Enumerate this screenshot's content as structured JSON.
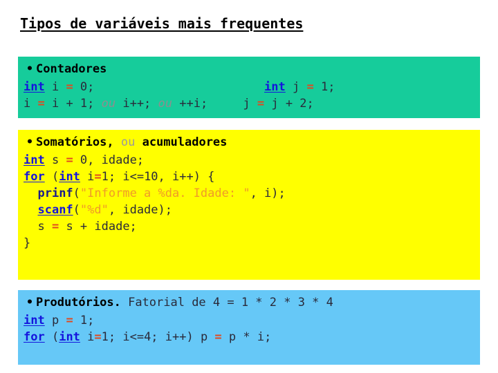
{
  "slide": {
    "title": "Tipos de variáveis mais frequentes",
    "background_color": "#ffffff"
  },
  "colors": {
    "green_block": "#16cc9b",
    "yellow_block": "#ffff00",
    "blue_block": "#66c8f7",
    "keyword": "#1414dd",
    "operator": "#e0491f",
    "string": "#f09a28",
    "comment_ou": "#8e8e8e",
    "code_text": "#2a2a3a",
    "title_text": "#000000"
  },
  "blocks": [
    {
      "id": "counters",
      "heading": {
        "bullet": "•",
        "text": "Contadores"
      },
      "lines": [
        {
          "left_tokens": [
            {
              "text": "int",
              "style": "keyword"
            },
            {
              "text": " i ",
              "style": "code"
            },
            {
              "text": "=",
              "style": "operator"
            },
            {
              "text": " 0;",
              "style": "code"
            }
          ],
          "right_tokens": [
            {
              "text": "int",
              "style": "keyword"
            },
            {
              "text": " j ",
              "style": "code"
            },
            {
              "text": "=",
              "style": "operator"
            },
            {
              "text": " 1;",
              "style": "code"
            }
          ]
        },
        {
          "left_tokens": [
            {
              "text": "i ",
              "style": "code"
            },
            {
              "text": "=",
              "style": "operator"
            },
            {
              "text": " i + 1; ",
              "style": "code"
            },
            {
              "text": "ou",
              "style": "comment"
            },
            {
              "text": " i++; ",
              "style": "code"
            },
            {
              "text": "ou",
              "style": "comment"
            },
            {
              "text": " ++i;",
              "style": "code"
            }
          ],
          "right_tokens": [
            {
              "text": "j ",
              "style": "code"
            },
            {
              "text": "=",
              "style": "operator"
            },
            {
              "text": " j + 2;",
              "style": "code"
            }
          ]
        }
      ]
    },
    {
      "id": "sums",
      "heading": {
        "bullet": "•",
        "text_before": "Somatórios,",
        "text_ou": " ou ",
        "text_after": "acumuladores"
      },
      "lines": [
        "int s = 0, idade;",
        "for (int i=1; i<=10, i++) {",
        "  prinf(\"Informe a %da. Idade: \", i);",
        "  scanf(\"%d\", idade);",
        "  s = s + idade;",
        "}"
      ]
    },
    {
      "id": "products",
      "heading": {
        "bullet": "•",
        "text_bold": "Produtórios.",
        "text_rest": " Fatorial de 4 = 1 * 2 * 3 * 4"
      },
      "lines": [
        "int p = 1;",
        "for (int i=1; i<=4; i++) p = p * i;"
      ]
    }
  ],
  "text": {
    "kw_int": "int",
    "kw_for": "for",
    "fn_prinf": "prinf",
    "fn_scanf": "scanf",
    "bullet": "•",
    "heading_contadores": "Contadores",
    "heading_somatorios": "Somatórios,",
    "heading_ou": "ou",
    "heading_acumuladores": "acumuladores",
    "heading_produtorios": "Produtórios.",
    "heading_fatorial": "Fatorial de 4 = 1 * 2 * 3 * 4",
    "ou": "ou",
    "c1_l1_left_a": " i ",
    "c1_l1_left_eq": "=",
    "c1_l1_left_b": " 0;",
    "c1_l1_right_a": " j ",
    "c1_l1_right_eq": "=",
    "c1_l1_right_b": " 1;",
    "c1_l2_a": "i ",
    "c1_l2_eq": "=",
    "c1_l2_b": " i + 1; ",
    "c1_l2_c": " i++; ",
    "c1_l2_d": " ++i;",
    "c1_l2_right_a": "j ",
    "c1_l2_right_eq": "=",
    "c1_l2_right_b": " j + 2;",
    "y_l1_a": " s ",
    "y_l1_eq": "=",
    "y_l1_b": " 0, idade;",
    "y_l2_a": " (",
    "y_l2_b": " i",
    "y_l2_eq": "=",
    "y_l2_c": "1; i<=10, i++) {",
    "y_l3_indent": "  ",
    "y_l3_paren": "(",
    "y_l3_str": "\"Informe a %da. Idade: \"",
    "y_l3_tail": ", i);",
    "y_l4_indent": "  ",
    "y_l4_paren": "(",
    "y_l4_str": "\"%d\"",
    "y_l4_tail": ", idade);",
    "y_l5": "  s ",
    "y_l5_eq": "=",
    "y_l5_b": " s + idade;",
    "y_l6": "}",
    "b_l1_a": " p ",
    "b_l1_eq": "=",
    "b_l1_b": " 1;",
    "b_l2_a": " (",
    "b_l2_b": " i",
    "b_l2_eq": "=",
    "b_l2_c": "1; i<=4; i++) p ",
    "b_l2_eq2": "=",
    "b_l2_d": " p * i;"
  }
}
